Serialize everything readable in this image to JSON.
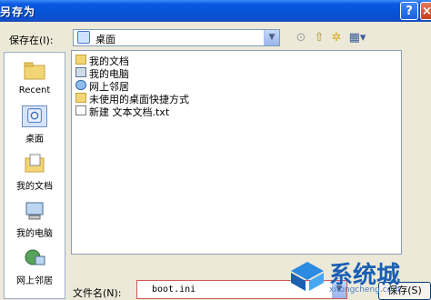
{
  "window": {
    "title": "另存为",
    "help_glyph": "?",
    "close_glyph": "×"
  },
  "save_in": {
    "label": "保存在(I):",
    "value": "桌面",
    "dropdown_glyph": "▼"
  },
  "toolbar": {
    "back_icon": "back-arrow-icon",
    "up_icon": "up-folder-icon",
    "new_folder_icon": "new-folder-icon",
    "views_icon": "views-menu-icon",
    "back_glyph": "⊙",
    "up_glyph": "⇧",
    "new_folder_glyph": "✲",
    "views_glyph": "▦▾"
  },
  "places": {
    "items": [
      {
        "label": "Recent",
        "icon": "recent-folder-icon"
      },
      {
        "label": "桌面",
        "icon": "desktop-icon",
        "selected": true
      },
      {
        "label": "我的文档",
        "icon": "my-documents-icon"
      },
      {
        "label": "我的电脑",
        "icon": "my-computer-icon"
      },
      {
        "label": "网上邻居",
        "icon": "network-icon"
      }
    ]
  },
  "files": {
    "items": [
      {
        "name": "我的文档",
        "icon": "folder-doc"
      },
      {
        "name": "我的电脑",
        "icon": "computer"
      },
      {
        "name": "网上邻居",
        "icon": "network"
      },
      {
        "name": "未使用的桌面快捷方式",
        "icon": "folder"
      },
      {
        "name": "新建 文本文档.txt",
        "icon": "txt"
      }
    ]
  },
  "filename": {
    "label": "文件名(N):",
    "value": "boot.ini",
    "dropdown_glyph": "▼"
  },
  "save_button": {
    "label": "保存(S)"
  },
  "watermark": {
    "brand": "系统城",
    "url": "xitongcheng.com"
  },
  "colors": {
    "title_bar": "#0553d6",
    "dialog_bg": "#ECE9D8",
    "watermark_blue": "#1a5fb4"
  }
}
